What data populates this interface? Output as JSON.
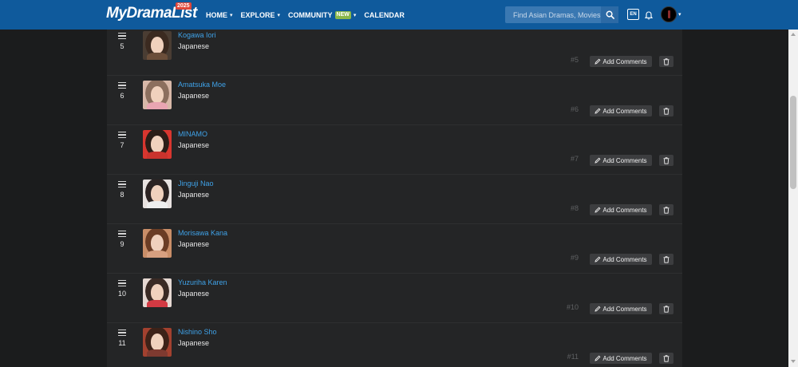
{
  "nav": {
    "logo_text": "MyDramaList",
    "logo_badge": "2025",
    "menu": [
      {
        "label": "HOME",
        "has_caret": true
      },
      {
        "label": "EXPLORE",
        "has_caret": true
      },
      {
        "label": "COMMUNITY",
        "badge": "NEW",
        "has_caret": true
      },
      {
        "label": "CALENDAR",
        "has_caret": false
      }
    ],
    "search_placeholder": "Find Asian Dramas, Movies",
    "search_icon": "search-icon",
    "language": "EN",
    "bell_icon": "bell-icon",
    "colors": {
      "bar": "#0f5a9c",
      "new_badge": "#8ab74a"
    }
  },
  "list": {
    "add_comments_label": "Add Comments",
    "link_color": "#3fa2e8",
    "rows": [
      {
        "num": "5",
        "name": "Kogawa Iori",
        "nationality": "Japanese",
        "rank": "#5",
        "hair": "#3b2a20",
        "top": "#6b4e3a",
        "bg": "#4a3d33"
      },
      {
        "num": "6",
        "name": "Amatsuka Moe",
        "nationality": "Japanese",
        "rank": "#6",
        "hair": "#8c6f5e",
        "top": "#e9a5b2",
        "bg": "#d8b8a8"
      },
      {
        "num": "7",
        "name": "MINAMO",
        "nationality": "Japanese",
        "rank": "#7",
        "hair": "#2b1d17",
        "top": "#c9332d",
        "bg": "#d8362f"
      },
      {
        "num": "8",
        "name": "Jinguji Nao",
        "nationality": "Japanese",
        "rank": "#8",
        "hair": "#2c2322",
        "top": "#eeeeee",
        "bg": "#e8e2e0"
      },
      {
        "num": "9",
        "name": "Morisawa Kana",
        "nationality": "Japanese",
        "rank": "#9",
        "hair": "#6b3d25",
        "top": "#d7a080",
        "bg": "#c98e68"
      },
      {
        "num": "10",
        "name": "Yuzuriha Karen",
        "nationality": "Japanese",
        "rank": "#10",
        "hair": "#3a2a24",
        "top": "#d33a43",
        "bg": "#e6d8d2"
      },
      {
        "num": "11",
        "name": "Nishino Sho",
        "nationality": "Japanese",
        "rank": "#11",
        "hair": "#3d2218",
        "top": "#7e3a30",
        "bg": "#a3412f"
      }
    ]
  }
}
